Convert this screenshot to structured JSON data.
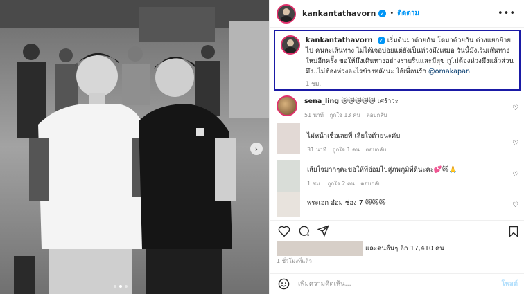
{
  "post": {
    "username": "kankantathavorn",
    "follow_label": "ติดตาม",
    "separator": "•",
    "more_label": "•••",
    "caption_text": "เริ่มต้นมาด้วยกัน โตมาด้วยกัน ต่างแยกย้ายไป คนละเส้นทาง ไม่ได้เจอบ่อยแต่ยังเป็นห่วงมึงเสมอ วันนี้มึงเริ่มเส้นทางใหม่อีกครั้ง ขอให้มึงเดินทางอย่างราบรื่นและมีสุข กูไม่ต้องห่วงมึงแล้วส่วนมึง..ไม่ต้องห่วงอะไรข้างหลังนะ ไอ้เพื่อนรัก",
    "caption_mention": "@omakapan",
    "caption_time": "1 ชม.",
    "likes_text": "และคนอื่นๆ อีก 17,410 คน",
    "posted_time": "1 ชั่วโมงที่แล้ว",
    "comment_placeholder": "เพิ่มความคิดเห็น...",
    "post_button": "โพสต์"
  },
  "comments": [
    {
      "username": "sena_ling",
      "text": "😿😿😿😿😿 เศร้าวะ",
      "time": "51 นาที",
      "likes": "ถูกใจ 13 คน",
      "reply": "ตอบกลับ"
    },
    {
      "username": "",
      "text": "ไม่หน้าเชื่อเลยพี่ เสียใจด้วยนะคับ",
      "time": "31 นาที",
      "likes": "ถูกใจ 1 คน",
      "reply": "ตอบกลับ"
    },
    {
      "username": "",
      "text": "เสียใจมากๆคะขอให้พี่อ๋อมไปสู่ภพภูมิที่ดีนะคะ💕😿🙏",
      "time": "1 ชม.",
      "likes": "ถูกใจ 2 คน",
      "reply": "ตอบกลับ"
    },
    {
      "username": "",
      "text": "พระเอก อ๋อม ช่อง 7 😿😿😿",
      "time": "",
      "likes": "",
      "reply": ""
    }
  ],
  "icons": [
    "verified-badge-icon",
    "heart-icon",
    "comment-icon",
    "share-icon",
    "bookmark-icon",
    "emoji-icon",
    "chevron-right-icon"
  ],
  "colors": {
    "accent_blue": "#0095f6",
    "caption_border": "#1a1aa6",
    "mention": "#00376b",
    "muted": "#8e8e8e"
  }
}
